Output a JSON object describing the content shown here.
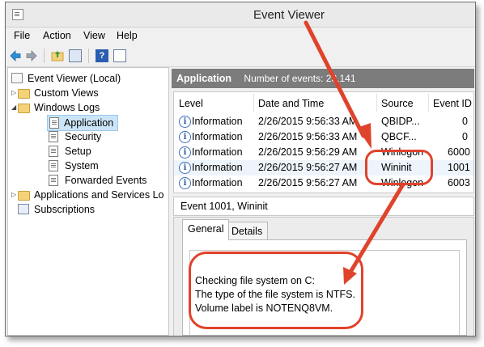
{
  "window": {
    "title": "Event Viewer"
  },
  "menu": [
    "File",
    "Action",
    "View",
    "Help"
  ],
  "tree": {
    "items": [
      {
        "label": "Event Viewer (Local)"
      },
      {
        "label": "Custom Views"
      },
      {
        "label": "Windows Logs"
      },
      {
        "label": "Application"
      },
      {
        "label": "Security"
      },
      {
        "label": "Setup"
      },
      {
        "label": "System"
      },
      {
        "label": "Forwarded Events"
      },
      {
        "label": "Applications and Services Lo"
      },
      {
        "label": "Subscriptions"
      }
    ]
  },
  "header": {
    "title": "Application",
    "count": "Number of events: 23,141"
  },
  "grid": {
    "columns": [
      "Level",
      "Date and Time",
      "Source",
      "Event ID"
    ],
    "rows": [
      [
        "Information",
        "2/26/2015 9:56:33 AM",
        "QBIDP...",
        "0"
      ],
      [
        "Information",
        "2/26/2015 9:56:33 AM",
        "QBCF...",
        "0"
      ],
      [
        "Information",
        "2/26/2015 9:56:29 AM",
        "Winlogon",
        "6000"
      ],
      [
        "Information",
        "2/26/2015 9:56:27 AM",
        "Wininit",
        "1001"
      ],
      [
        "Information",
        "2/26/2015 9:56:27 AM",
        "Winlogon",
        "6003"
      ]
    ]
  },
  "detail": {
    "title": "Event 1001, Wininit",
    "tabs": [
      "General",
      "Details"
    ],
    "message": [
      "Checking file system on C:",
      "The type of the file system is NTFS.",
      "Volume label is NOTENQ8VM."
    ]
  },
  "colors": {
    "annotation": "#e0432b",
    "header_bg": "#7c7c7c",
    "selection": "#cce4f7"
  },
  "icons": {
    "back": "back-arrow-icon",
    "forward": "forward-arrow-icon",
    "folder": "folder-up-icon",
    "panel": "show-hide-tree-icon",
    "help": "help-icon",
    "properties": "properties-icon",
    "info": "information-icon"
  }
}
